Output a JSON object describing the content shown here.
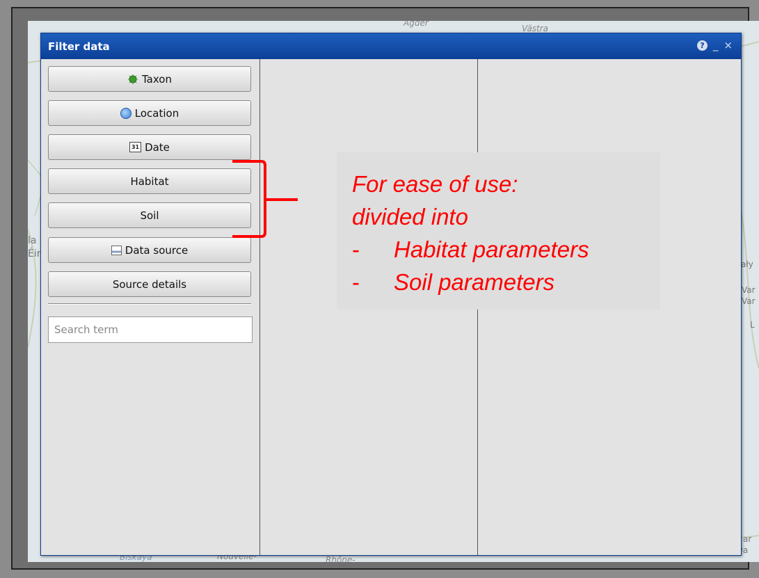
{
  "window": {
    "title": "Filter data",
    "help_label": "?",
    "minimize_label": "_",
    "close_label": "×"
  },
  "buttons": {
    "taxon": "Taxon",
    "location": "Location",
    "date": "Date",
    "date_icon_text": "31",
    "habitat": "Habitat",
    "soil": "Soil",
    "data_source": "Data source",
    "source_details": "Source details"
  },
  "search": {
    "placeholder": "Search term",
    "value": ""
  },
  "callout": {
    "line1": "For ease of use:",
    "line2": "divided into",
    "bullet1": "Habitat parameters",
    "bullet2": "Soil parameters",
    "dash": "-",
    "color": "#ff0000"
  },
  "map_labels": {
    "agder": "Agder",
    "vastra": "Västra",
    "biskaya": "Biskaya",
    "nouvelle": "Nouvelle-",
    "rhone": "Rhône-",
    "la": "la",
    "eir": "Éir",
    "aly": "ały",
    "var1": "Var",
    "var2": "Var",
    "l": "L",
    "bar": "ar",
    "temeswa": "Temeswa"
  },
  "colors": {
    "titlebar": "#0b3f96",
    "panel": "#e3e3e3",
    "callout_text": "#ff0000"
  }
}
